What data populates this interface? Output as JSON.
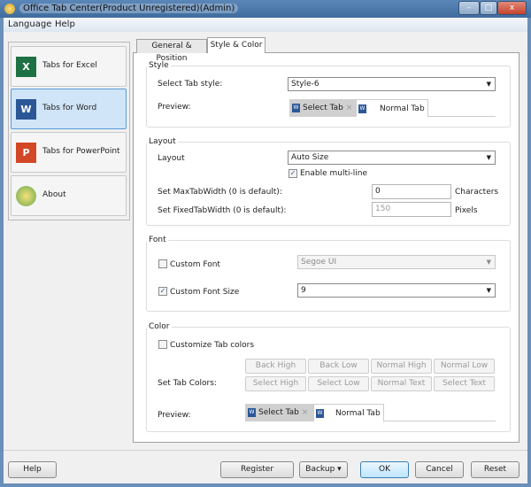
{
  "window": {
    "title": "Office Tab Center(Product Unregistered)(Admin)",
    "minimize": "–",
    "maximize": "□",
    "close": "x"
  },
  "menu": [
    "Language",
    "Help"
  ],
  "sidebar": {
    "items": [
      {
        "label": "Tabs for Excel",
        "icon": "excel-icon",
        "glyph": "X",
        "color": "#1e7145"
      },
      {
        "label": "Tabs for Word",
        "icon": "word-icon",
        "glyph": "W",
        "color": "#2b5797",
        "selected": true
      },
      {
        "label": "Tabs for PowerPoint",
        "icon": "powerpoint-icon",
        "glyph": "P",
        "color": "#d24726"
      },
      {
        "label": "About",
        "icon": "about-icon",
        "glyph": "",
        "color": "#e8b23a"
      }
    ]
  },
  "tabs": [
    {
      "label": "General & Position"
    },
    {
      "label": "Style & Color",
      "active": true
    }
  ],
  "style": {
    "title": "Style",
    "select_label": "Select Tab style:",
    "select_value": "Style-6",
    "preview_label": "Preview:",
    "select_tab": "Select Tab",
    "normal_tab": "Normal Tab",
    "close_glyph": "×",
    "word_glyph": "W"
  },
  "layout": {
    "title": "Layout",
    "layout_label": "Layout",
    "layout_value": "Auto Size",
    "multiline_label": "Enable multi-line",
    "multiline_checked": true,
    "max_label": "Set MaxTabWidth (0 is default):",
    "max_value": "0",
    "max_unit": "Characters",
    "fixed_label": "Set FixedTabWidth (0 is default):",
    "fixed_value": "150",
    "fixed_unit": "Pixels"
  },
  "font": {
    "title": "Font",
    "custom_font_label": "Custom Font",
    "custom_font_checked": false,
    "font_value": "Segoe UI",
    "custom_size_label": "Custom Font Size",
    "custom_size_checked": true,
    "size_value": "9"
  },
  "color": {
    "title": "Color",
    "customize_label": "Customize Tab colors",
    "customize_checked": false,
    "set_label": "Set Tab Colors:",
    "buttons": [
      "Back High",
      "Back Low",
      "Normal High",
      "Normal Low",
      "Select High",
      "Select Low",
      "Normal Text",
      "Select Text"
    ],
    "preview_label": "Preview:",
    "select_tab": "Select Tab",
    "normal_tab": "Normal Tab"
  },
  "footer": {
    "help": "Help",
    "register": "Register",
    "backup": "Backup",
    "backup_arrow": "▾",
    "ok": "OK",
    "cancel": "Cancel",
    "reset": "Reset"
  },
  "check_glyph": "✓",
  "arrow_glyph": "▼"
}
